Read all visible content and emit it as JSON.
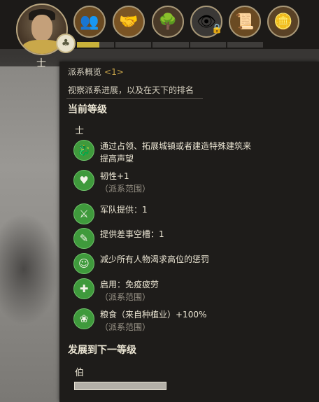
{
  "character": {
    "rank_char": "士",
    "badge_icon": "faction-emblem-icon"
  },
  "top_icons": [
    {
      "name": "court-icon",
      "glyph": "👥",
      "bg": "#6a4a22"
    },
    {
      "name": "handshake-icon",
      "glyph": "🤝",
      "bg": "#7a5424"
    },
    {
      "name": "tree-icon",
      "glyph": "🌳",
      "bg": "#4a3a28"
    },
    {
      "name": "eye-icon",
      "glyph": "👁",
      "bg": "#3a3836"
    },
    {
      "name": "scroll-icon",
      "glyph": "📜",
      "bg": "#6a4a22"
    },
    {
      "name": "coins-icon",
      "glyph": "🪙",
      "bg": "#5a4226"
    }
  ],
  "lock_icon": "lock-icon",
  "progress": {
    "fraction": 0.12
  },
  "tooltip": {
    "title": "派系概览",
    "title_key": "<1>",
    "subtitle": "视察派系进展，以及在天下的排名",
    "current_level_heading": "当前等级",
    "current_rank": "士",
    "effects": [
      {
        "icon": "dragon-icon",
        "glyph": "🐉",
        "text": "通过占领、拓展城镇或者建造特殊建筑来提高声望",
        "scope": ""
      },
      {
        "icon": "heart-plus-icon",
        "glyph": "♥",
        "text": "韧性+1",
        "scope": "（派系范围）"
      },
      {
        "icon": "army-supply-icon",
        "glyph": "⚔",
        "text": "军队提供：1",
        "scope": ""
      },
      {
        "icon": "assignment-slot-icon",
        "glyph": "✎",
        "text": "提供差事空槽：1",
        "scope": ""
      },
      {
        "icon": "person-portrait-icon",
        "glyph": "☺",
        "text": "减少所有人物渴求高位的惩罚",
        "scope": ""
      },
      {
        "icon": "plague-immunity-icon",
        "glyph": "✚",
        "text": "启用：免疫疲劳",
        "scope": "（派系范围）"
      },
      {
        "icon": "grain-basket-icon",
        "glyph": "❀",
        "text": "粮食（来自种植业）+100%",
        "scope": "（派系范围）"
      }
    ],
    "next_level_heading": "发展到下一等级",
    "next_rank": "伯",
    "next_progress": 0
  }
}
